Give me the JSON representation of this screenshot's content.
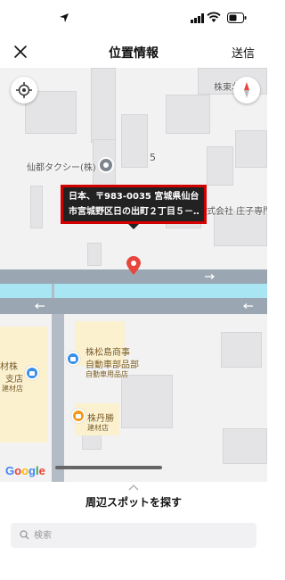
{
  "status_bar": {
    "icons": [
      "location-arrow-icon",
      "signal-icon",
      "wifi-icon",
      "battery-icon"
    ]
  },
  "header": {
    "close_icon": "close-icon",
    "title": "位置情報",
    "send_label": "送信"
  },
  "map": {
    "tooltip_line1": "日本、〒983-0035 宮城県仙台",
    "tooltip_line2": "市宮城野区日の出町２丁目５－…",
    "labels": {
      "taxi": "仙都タクシー(株)",
      "block_number": "5",
      "shoji": "株式会社 庄子専門",
      "top_right": "株東北"
    },
    "pois": {
      "matsushima_name1": "株松島商事",
      "matsushima_name2": "自動車部品部",
      "matsushima_sub": "自動車用品店",
      "tanshou_name": "株丹勝",
      "tanshou_sub": "建材店",
      "left_name1": "材株",
      "left_name2": "支店",
      "left_sub": "建材店"
    },
    "google_letters": [
      "G",
      "o",
      "o",
      "g",
      "l",
      "e"
    ],
    "colors": {
      "google_blue": "#4285F4",
      "google_red": "#EA4335",
      "google_yellow": "#FBBC05",
      "google_green": "#34A853",
      "pin_red": "#e8453c",
      "tooltip_border": "#d40000"
    }
  },
  "bottom_sheet": {
    "heading": "周辺スポットを探す",
    "search_placeholder": "検索"
  }
}
